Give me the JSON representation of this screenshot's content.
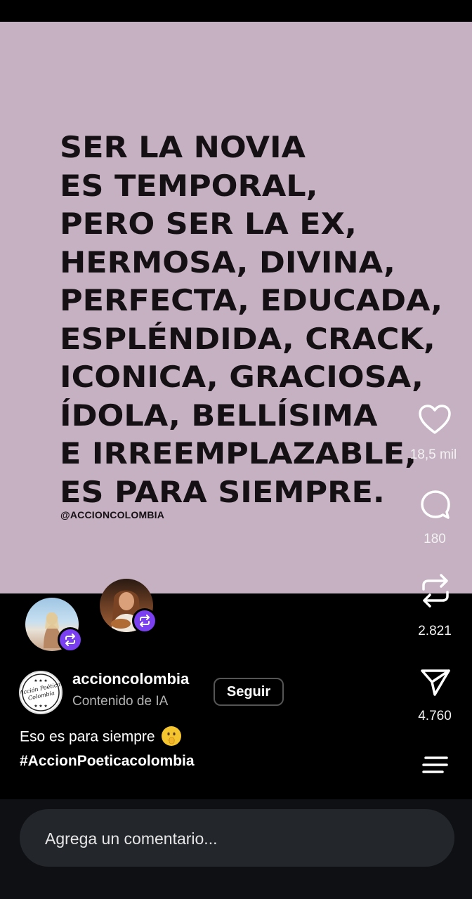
{
  "post": {
    "quote_lines": "SER LA NOVIA\nES TEMPORAL,\nPERO SER LA EX,\nHERMOSA, DIVINA,\nPERFECTA, EDUCADA,\nESPLÉNDIDA, CRACK,\nICONICA, GRACIOSA,\nÍDOLA, BELLÍSIMA\nE IRREEMPLAZABLE,\nES PARA SIEMPRE.",
    "watermark": "@ACCIONCOLOMBIA",
    "background": "#c6b1c2"
  },
  "actions": {
    "likes": "18,5 mil",
    "comments": "180",
    "reposts": "2.821",
    "shares": "4.760"
  },
  "author": {
    "username": "accioncolombia",
    "label": "Contenido de IA",
    "follow_label": "Seguir",
    "avatar_text": "ACCIÓN POÉTICA COLOMBIA"
  },
  "caption": {
    "text": "Eso es para siempre",
    "hashtag": "#AccionPoeticacolombia"
  },
  "comment": {
    "placeholder": "Agrega un comentario..."
  },
  "icons": [
    "heart-icon",
    "comment-icon",
    "repost-icon",
    "send-icon",
    "menu-icon"
  ],
  "colors": {
    "accent": "#7b3ff2",
    "badge": "#7b3ff2"
  }
}
